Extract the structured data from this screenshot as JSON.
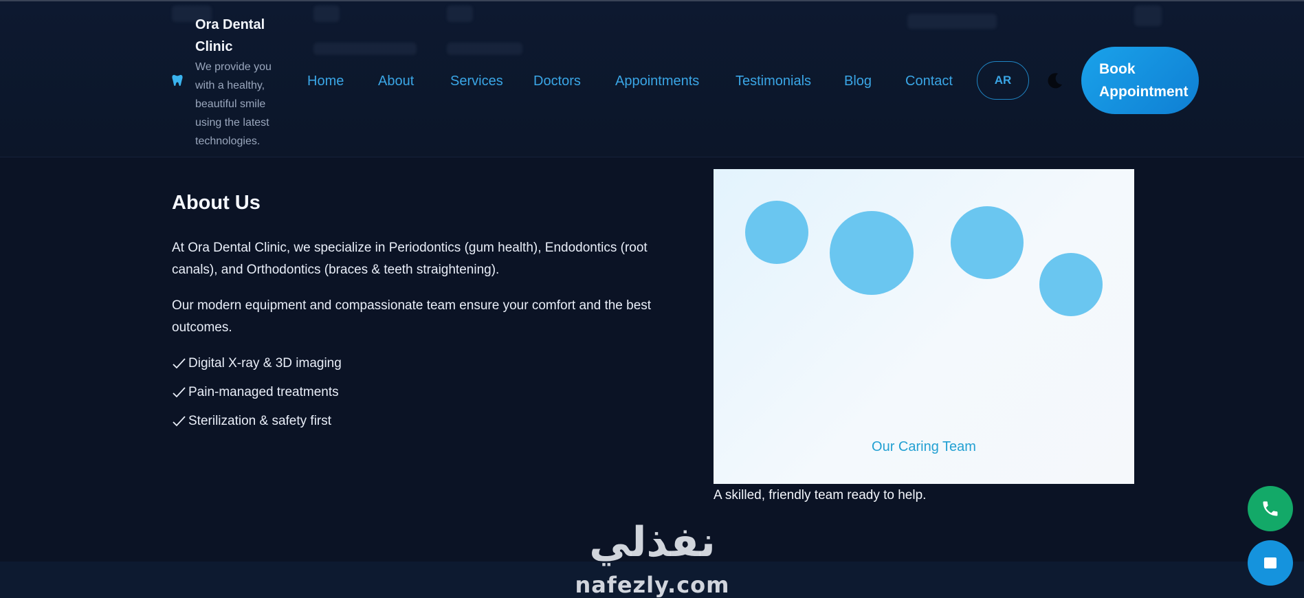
{
  "colors": {
    "background": "#0b1325",
    "accent": "#3aa6e6",
    "primary_button": "#1593dd",
    "call_button": "#13a968",
    "team_circle": "#6ac6f0"
  },
  "brand": {
    "name": "Ora Dental Clinic",
    "tagline": "We provide you with a healthy, beautiful smile using the latest technologies.",
    "icon": "tooth-icon"
  },
  "nav": {
    "items": [
      {
        "label": "Home"
      },
      {
        "label": "About"
      },
      {
        "label": "Services"
      },
      {
        "label": "Doctors"
      },
      {
        "label": "Appointments"
      },
      {
        "label": "Testimonials"
      },
      {
        "label": "Blog"
      },
      {
        "label": "Contact"
      }
    ],
    "lang_label": "AR",
    "theme_icon": "moon-icon",
    "book_label": "Book Appointment"
  },
  "about": {
    "title": "About Us",
    "para1": "At Ora Dental Clinic, we specialize in Periodontics (gum health), Endodontics (root canals), and Orthodontics (braces & teeth straightening).",
    "para2": "Our modern equipment and compassionate team ensure your comfort and the best outcomes.",
    "features": [
      {
        "label": "Digital X-ray & 3D imaging",
        "icon": "check-icon"
      },
      {
        "label": "Pain-managed treatments",
        "icon": "check-icon"
      },
      {
        "label": "Sterilization & safety first",
        "icon": "check-icon"
      }
    ],
    "team_caption": "Our Caring Team",
    "team_subcaption": "A skilled, friendly team ready to help."
  },
  "floating": {
    "call_icon": "phone-icon",
    "chat_icon": "chat-icon"
  },
  "watermark": {
    "arabic": "نفذلي",
    "latin": "nafezly.com"
  }
}
